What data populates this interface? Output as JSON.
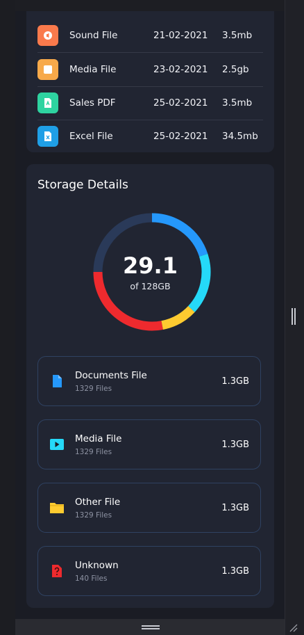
{
  "files": [
    {
      "name": "Sound File",
      "date": "21-02-2021",
      "size": "3.5mb",
      "icon": "sound-file-icon",
      "color": "#fa7a4c"
    },
    {
      "name": "Media File",
      "date": "23-02-2021",
      "size": "2.5gb",
      "icon": "media-file-icon",
      "color": "#f7a94a"
    },
    {
      "name": "Sales PDF",
      "date": "25-02-2021",
      "size": "3.5mb",
      "icon": "pdf-icon",
      "color": "#2ed3a0"
    },
    {
      "name": "Excel File",
      "date": "25-02-2021",
      "size": "34.5mb",
      "icon": "excel-icon",
      "color": "#1f9fe6"
    }
  ],
  "storage": {
    "title": "Storage Details",
    "used": "29.1",
    "total_label": "of 128GB",
    "segments": [
      {
        "color": "#2598fb",
        "fraction": 0.2
      },
      {
        "color": "#25d9f8",
        "fraction": 0.17
      },
      {
        "color": "#fecb30",
        "fraction": 0.1
      },
      {
        "color": "#ee2a2e",
        "fraction": 0.28
      },
      {
        "color": "#2a3a59",
        "fraction": 0.25
      }
    ],
    "categories": [
      {
        "name": "Documents File",
        "count": "1329 Files",
        "size": "1.3GB",
        "icon": "document-icon",
        "color": "#2598fb"
      },
      {
        "name": "Media File",
        "count": "1329 Files",
        "size": "1.3GB",
        "icon": "play-icon",
        "color": "#25d9f8"
      },
      {
        "name": "Other File",
        "count": "1329 Files",
        "size": "1.3GB",
        "icon": "folder-icon",
        "color": "#fecb30"
      },
      {
        "name": "Unknown",
        "count": "140 Files",
        "size": "1.3GB",
        "icon": "unknown-file-icon",
        "color": "#ee2a2e"
      }
    ]
  }
}
